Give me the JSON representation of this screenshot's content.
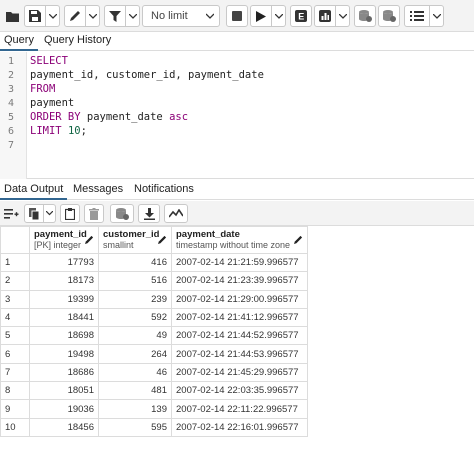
{
  "toolbar": {
    "limit_label": "No limit",
    "buttons": [
      "open-file",
      "save",
      "edit",
      "filter",
      "stop",
      "execute",
      "explain",
      "explain-analyze",
      "commit",
      "rollback",
      "macros"
    ]
  },
  "query_tabs": [
    "Query",
    "Query History"
  ],
  "editor": {
    "line_numbers": [
      "1",
      "2",
      "3",
      "4",
      "5",
      "6",
      "7"
    ],
    "lines": [
      {
        "keyword": "SELECT",
        "rest": ""
      },
      {
        "keyword": "",
        "rest": "payment_id, customer_id, payment_date"
      },
      {
        "keyword": "FROM",
        "rest": ""
      },
      {
        "keyword": "",
        "rest": "payment"
      },
      {
        "keyword": "ORDER BY",
        "rest": " payment_date ",
        "keyword2": "asc"
      },
      {
        "keyword": "LIMIT",
        "rest": " ",
        "number": "10",
        "tail": ";"
      },
      {
        "keyword": "",
        "rest": ""
      }
    ]
  },
  "output_tabs": [
    "Data Output",
    "Messages",
    "Notifications"
  ],
  "grid": {
    "columns": [
      {
        "name": "payment_id",
        "type": "[PK] integer"
      },
      {
        "name": "customer_id",
        "type": "smallint"
      },
      {
        "name": "payment_date",
        "type": "timestamp without time zone"
      }
    ],
    "rows": [
      {
        "n": "1",
        "payment_id": "17793",
        "customer_id": "416",
        "payment_date": "2007-02-14 21:21:59.996577"
      },
      {
        "n": "2",
        "payment_id": "18173",
        "customer_id": "516",
        "payment_date": "2007-02-14 21:23:39.996577"
      },
      {
        "n": "3",
        "payment_id": "19399",
        "customer_id": "239",
        "payment_date": "2007-02-14 21:29:00.996577"
      },
      {
        "n": "4",
        "payment_id": "18441",
        "customer_id": "592",
        "payment_date": "2007-02-14 21:41:12.996577"
      },
      {
        "n": "5",
        "payment_id": "18698",
        "customer_id": "49",
        "payment_date": "2007-02-14 21:44:52.996577"
      },
      {
        "n": "6",
        "payment_id": "19498",
        "customer_id": "264",
        "payment_date": "2007-02-14 21:44:53.996577"
      },
      {
        "n": "7",
        "payment_id": "18686",
        "customer_id": "46",
        "payment_date": "2007-02-14 21:45:29.996577"
      },
      {
        "n": "8",
        "payment_id": "18051",
        "customer_id": "481",
        "payment_date": "2007-02-14 22:03:35.996577"
      },
      {
        "n": "9",
        "payment_id": "19036",
        "customer_id": "139",
        "payment_date": "2007-02-14 22:11:22.996577"
      },
      {
        "n": "10",
        "payment_id": "18456",
        "customer_id": "595",
        "payment_date": "2007-02-14 22:16:01.996577"
      }
    ]
  }
}
